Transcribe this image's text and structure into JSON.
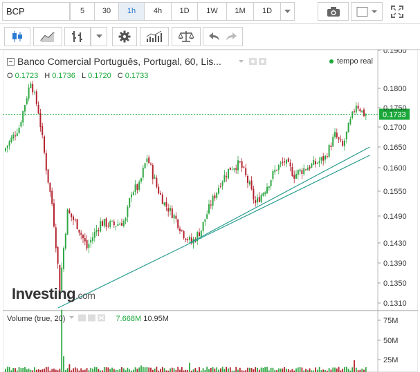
{
  "toolbar": {
    "symbol": "BCP",
    "intervals": [
      "5",
      "30",
      "1h",
      "4h",
      "1D",
      "1W",
      "1M",
      "1D"
    ],
    "active_interval": "1h"
  },
  "legend": {
    "title": "Banco Comercial Português, Portugal, 60, Lis...",
    "o_label": "O",
    "o_value": "0.1723",
    "h_label": "H",
    "h_value": "0.1736",
    "l_label": "L",
    "l_value": "0.1720",
    "c_label": "C",
    "c_value": "0.1733",
    "realtime": "tempo real"
  },
  "volume_legend": {
    "label": "Volume (true, 20)",
    "value1": "7.668M",
    "value2": "10.95M"
  },
  "logo": {
    "brand": "Investing",
    "domain": ".com"
  },
  "colors": {
    "up": "#2fa844",
    "down": "#b3232e",
    "trend": "#2a9d8f",
    "last_price": "#1aa83a"
  },
  "chart_data": {
    "type": "candlestick",
    "y_ticks": [
      "0.1900",
      "0.1800",
      "0.1750",
      "0.1700",
      "0.1650",
      "0.1600",
      "0.1550",
      "0.1490",
      "0.1430",
      "0.1390",
      "0.1350",
      "0.1310"
    ],
    "ylim": [
      0.131,
      0.19
    ],
    "last_price": "0.1733",
    "volume_ticks": [
      "75M",
      "50M",
      "25M"
    ],
    "anchors": [
      [
        0,
        0.164
      ],
      [
        8,
        0.17
      ],
      [
        14,
        0.182
      ],
      [
        18,
        0.174
      ],
      [
        22,
        0.16
      ],
      [
        25,
        0.152
      ],
      [
        29,
        0.134
      ],
      [
        33,
        0.15
      ],
      [
        38,
        0.147
      ],
      [
        43,
        0.142
      ],
      [
        50,
        0.1475
      ],
      [
        57,
        0.147
      ],
      [
        63,
        0.148
      ],
      [
        66,
        0.155
      ],
      [
        70,
        0.156
      ],
      [
        74,
        0.1625
      ],
      [
        79,
        0.156
      ],
      [
        83,
        0.152
      ],
      [
        88,
        0.149
      ],
      [
        93,
        0.145
      ],
      [
        97,
        0.143
      ],
      [
        102,
        0.146
      ],
      [
        107,
        0.152
      ],
      [
        112,
        0.157
      ],
      [
        117,
        0.16
      ],
      [
        122,
        0.161
      ],
      [
        127,
        0.156
      ],
      [
        130,
        0.152
      ],
      [
        135,
        0.1555
      ],
      [
        141,
        0.16
      ],
      [
        145,
        0.1615
      ],
      [
        150,
        0.1585
      ],
      [
        156,
        0.16
      ],
      [
        161,
        0.161
      ],
      [
        166,
        0.1625
      ],
      [
        171,
        0.168
      ],
      [
        175,
        0.165
      ],
      [
        178,
        0.17
      ],
      [
        182,
        0.176
      ],
      [
        186,
        0.1733
      ]
    ],
    "trendlines": [
      {
        "from": [
          27,
          0.13
        ],
        "to": [
          188,
          0.163
        ]
      },
      {
        "from": [
          95,
          0.143
        ],
        "to": [
          188,
          0.165
        ]
      }
    ]
  }
}
